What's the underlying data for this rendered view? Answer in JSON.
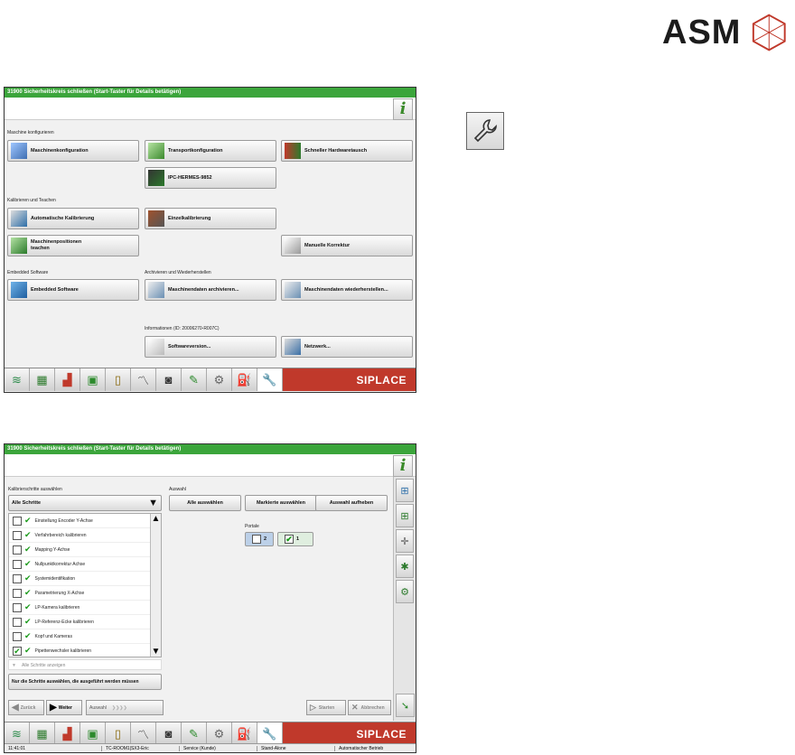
{
  "logo": {
    "text": "ASM"
  },
  "screen1": {
    "title": "31900 Sicherheitskreis schließen (Start-Taster für Details betätigen)",
    "info_label": "i",
    "sections": {
      "configure": "Maschine konfigurieren",
      "calibrate": "Kalibrieren und Teachen",
      "embedded": "Embedded Software",
      "archive": "Archivieren und Wiederherstellen",
      "info": "Informationen (ID: 20006270-R007C)"
    },
    "buttons": {
      "machine_config": "Maschinenkonfiguration",
      "transport_config": "Transportkonfiguration",
      "hw_exchange": "Schneller Hardwaretausch",
      "ipc": "IPC-HERMES-9852",
      "auto_cal": "Automatische Kalibrierung",
      "single_cal": "Einzelkalibrierung",
      "teach_pos": "Maschinenpositionen\nteachen",
      "manual_corr": "Manuelle Korrektur",
      "embedded_sw": "Embedded Software",
      "archive_data": "Maschinendaten archivieren...",
      "restore_data": "Maschinendaten wiederherstellen...",
      "sw_version": "Softwareversion...",
      "network": "Netzwerk..."
    },
    "brand": "SIPLACE"
  },
  "screen2": {
    "title": "31900 Sicherheitskreis schließen (Start-Taster für Details betätigen)",
    "info_label": "i",
    "steps_section": "Kalibrierschritte auswählen",
    "selection_section": "Auswahl",
    "dropdown_value": "Alle Schritte",
    "steps": [
      {
        "label": "Einstellung Encoder Y-Achse",
        "checked": false
      },
      {
        "label": "Verfahrbereich kalibrieren",
        "checked": false
      },
      {
        "label": "Mapping Y-Achse",
        "checked": false
      },
      {
        "label": "Nullpunktkorrektur Achse",
        "checked": false
      },
      {
        "label": "Systemidentifikation",
        "checked": false
      },
      {
        "label": "Parametrierung X-Achse",
        "checked": false
      },
      {
        "label": "LP-Kamera kalibrieren",
        "checked": false
      },
      {
        "label": "LP-Referenz-Ecke kalibrieren",
        "checked": false
      },
      {
        "label": "Kopf und Kameras",
        "checked": false
      },
      {
        "label": "Pipettenwechsler kalibrieren",
        "checked": true
      }
    ],
    "filter_label": "Alle Schritte anzeigen",
    "hint_button": "Nur die Schritte auswählen, die ausgeführt werden müssen",
    "select_all": "Alle auswählen",
    "select_marked": "Markierte auswählen",
    "clear_selection": "Auswahl aufheben",
    "portals_label": "Portale",
    "portal_2": "2",
    "portal_1": "1",
    "back": "Zurück",
    "next": "Weiter",
    "crumb": "Auswahl",
    "start": "Starten",
    "cancel": "Abbrechen",
    "brand": "SIPLACE",
    "status": {
      "time": "11:41:01",
      "station": "TC-ROOM1|SX3-Eric",
      "mode": "Service (Kunde)",
      "connection": "Stand-Alone",
      "operation": "Automatischer Betrieb"
    }
  }
}
